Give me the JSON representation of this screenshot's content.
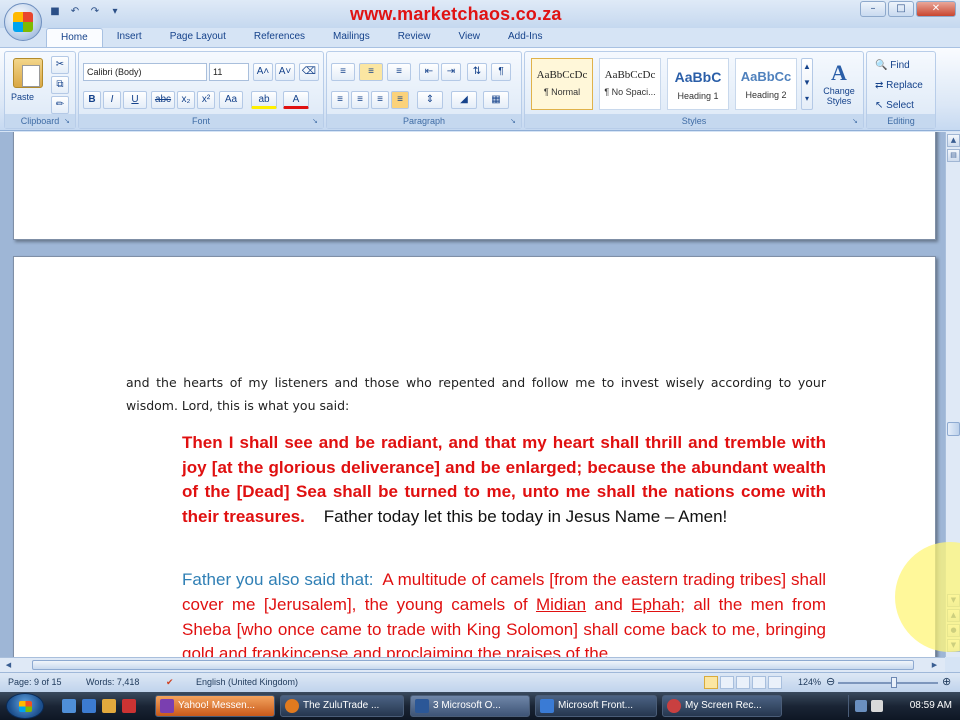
{
  "watermark": "www.marketchaos.co.za",
  "ribbon": {
    "tabs": [
      "Home",
      "Insert",
      "Page Layout",
      "References",
      "Mailings",
      "Review",
      "View",
      "Add-Ins"
    ],
    "active_tab": "Home",
    "clipboard": {
      "paste_label": "Paste",
      "group_label": "Clipboard"
    },
    "font": {
      "font_name": "Calibri (Body)",
      "font_size": "11",
      "group_label": "Font"
    },
    "paragraph": {
      "group_label": "Paragraph"
    },
    "styles": {
      "group_label": "Styles",
      "items": [
        {
          "sample": "AaBbCcDc",
          "name": "¶ Normal"
        },
        {
          "sample": "AaBbCcDc",
          "name": "¶ No Spaci..."
        },
        {
          "sample": "AaBbC",
          "name": "Heading 1"
        },
        {
          "sample": "AaBbCc",
          "name": "Heading 2"
        }
      ],
      "change_styles": "Change Styles"
    },
    "editing": {
      "group_label": "Editing",
      "find": "Find",
      "replace": "Replace",
      "select": "Select"
    }
  },
  "document": {
    "intro": "and the hearts of my listeners and those who repented and follow me to invest wisely according to your wisdom. Lord, this is what you said:",
    "quote1_red": "Then I shall see and be radiant, and that my heart shall thrill and tremble with joy [at the glorious deliverance] and be enlarged; because the abundant wealth of the [Dead] Sea shall be turned to me, unto me shall the nations come with their treasures.",
    "quote1_black": "Father today let this be today in Jesus Name – Amen!",
    "quote2_blue": "Father you also said that:",
    "quote2_red_a": "A multitude of camels [from the eastern trading tribes] shall cover me [Jerusalem], the young camels of",
    "midian": "Midian",
    "and": "and",
    "ephah": "Ephah;",
    "quote2_red_b": "all the men from Sheba [who once came to trade with King Solomon] shall come back to me, bringing gold and frankincense and proclaiming the praises of the"
  },
  "statusbar": {
    "page": "Page: 9 of 15",
    "words": "Words: 7,418",
    "language": "English (United Kingdom)",
    "zoom": "124%"
  },
  "taskbar": {
    "tasks": [
      {
        "label": "Yahoo! Messen...",
        "color": "#7a3fb0"
      },
      {
        "label": "The ZuluTrade ...",
        "color": "#e07a1f"
      },
      {
        "label": "3 Microsoft O...",
        "color": "#2b5797"
      },
      {
        "label": "Microsoft Front...",
        "color": "#3a7bd5"
      },
      {
        "label": "My Screen Rec...",
        "color": "#c94040"
      }
    ],
    "clock": "08:59 AM"
  }
}
